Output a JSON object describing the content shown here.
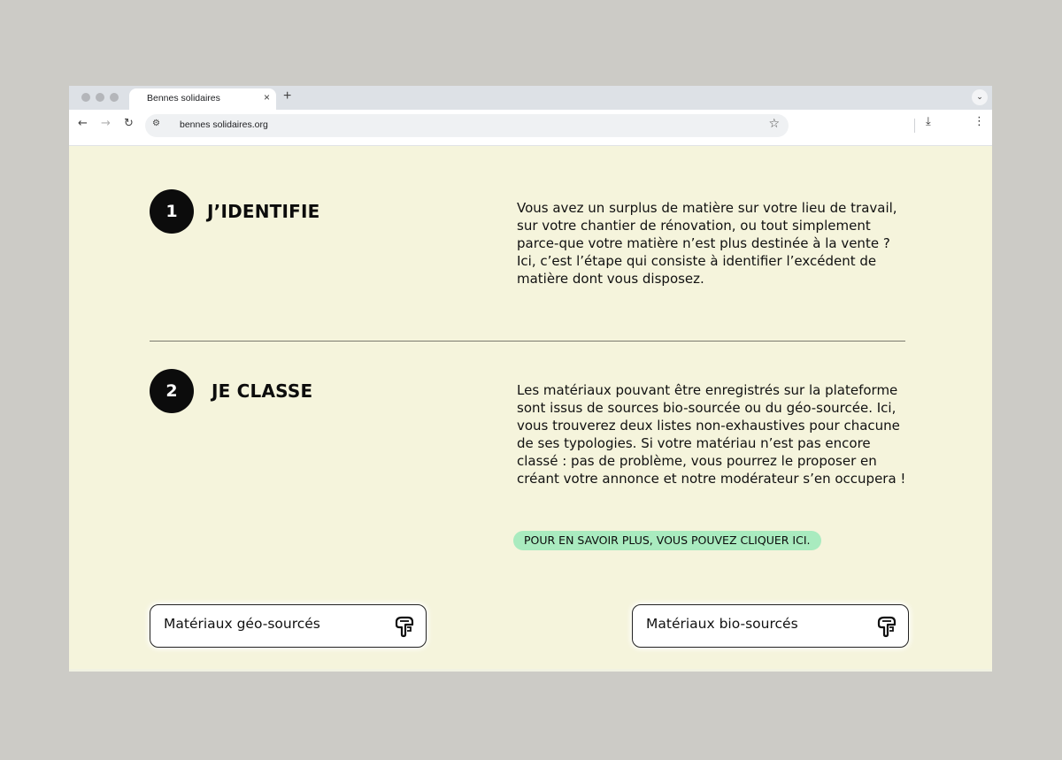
{
  "browser": {
    "tab_title": "Bennes solidaires",
    "tab_close": "×",
    "new_tab": "+",
    "url": "bennes solidaires.org",
    "icons": [
      "back-icon",
      "forward-icon",
      "reload-icon",
      "site-info-icon",
      "bookmark-star-icon",
      "download-icon",
      "more-menu-icon",
      "tab-menu-icon"
    ]
  },
  "steps": [
    {
      "number": "1",
      "title": "J’IDENTIFIE",
      "text": "Vous avez un surplus de matière sur votre lieu de travail, sur votre chantier de rénovation, ou tout simplement parce-que votre matière n’est plus destinée à la vente ? Ici, c’est l’étape qui consiste à identifier l’excédent de matière dont vous disposez."
    },
    {
      "number": "2",
      "title": "JE CLASSE",
      "text": "Les matériaux pouvant être enregistrés sur la plateforme sont issus de sources bio-sourcée ou du géo-sourcée. Ici, vous trouverez deux listes non-exhaustives pour chacune de ses typologies. Si votre matériau n’est pas encore classé : pas de problème, vous pourrez le proposer en créant votre annonce et notre modérateur s’en occupera !"
    }
  ],
  "cta": {
    "label": "POUR EN SAVOIR PLUS, VOUS POUVEZ CLIQUER ICI.",
    "color": "#a9ebbf"
  },
  "materials": [
    {
      "label": "Matériaux géo-sourcés",
      "icon": "material-icon"
    },
    {
      "label": "Matériaux bio-sourcés",
      "icon": "material-icon"
    }
  ],
  "colors": {
    "page_background": "#f5f4dc",
    "badge": "#0c0c0c",
    "outer_background": "#cccbc6"
  }
}
